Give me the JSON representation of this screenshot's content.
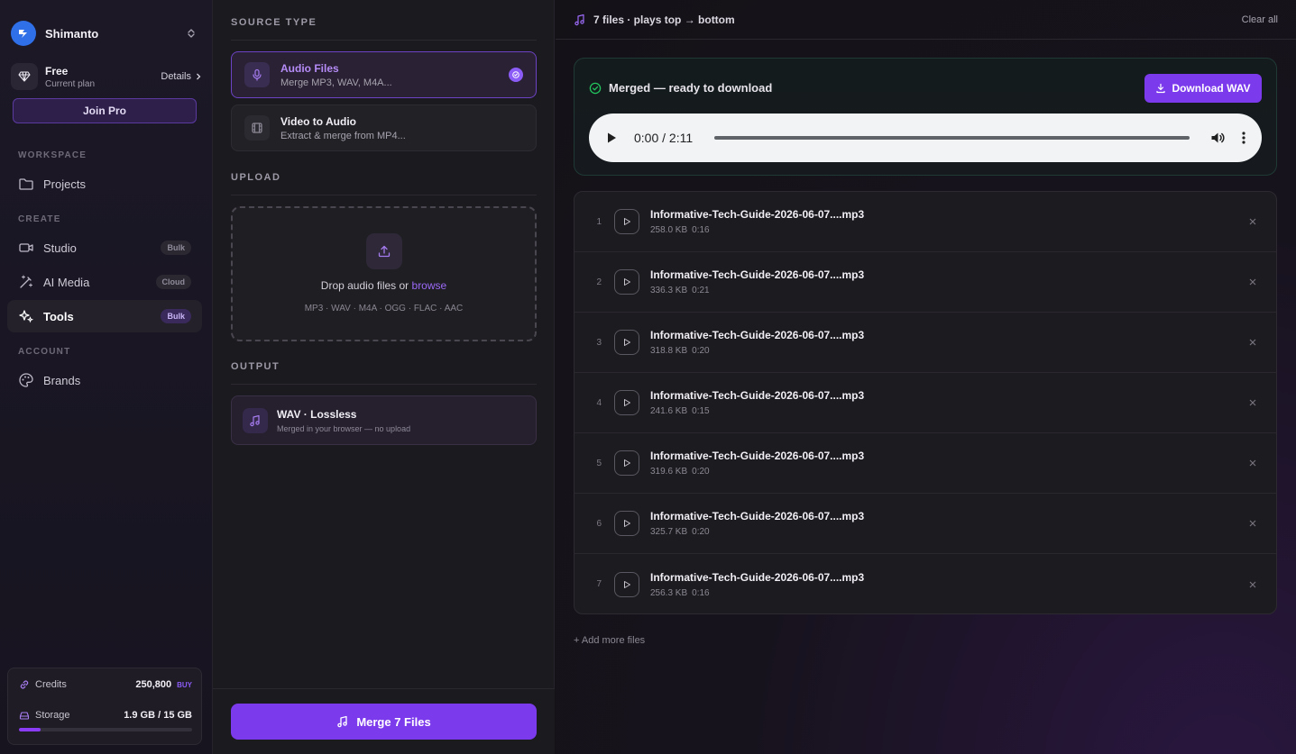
{
  "sidebar": {
    "user_name": "Shimanto",
    "plan": {
      "name": "Free",
      "sub": "Current plan",
      "details": "Details"
    },
    "join_pro": "Join Pro",
    "sections": {
      "workspace": "WORKSPACE",
      "create": "CREATE",
      "account": "ACCOUNT"
    },
    "items": {
      "projects": {
        "label": "Projects",
        "icon": "folder-icon"
      },
      "studio": {
        "label": "Studio",
        "badge": "Bulk",
        "icon": "video-icon"
      },
      "ai_media": {
        "label": "AI Media",
        "badge": "Cloud",
        "icon": "magic-wand-icon"
      },
      "tools": {
        "label": "Tools",
        "badge": "Bulk",
        "icon": "sparkles-icon"
      },
      "brands": {
        "label": "Brands",
        "icon": "palette-icon"
      }
    },
    "usage": {
      "credits_label": "Credits",
      "credits_value": "250,800",
      "buy": "BUY",
      "storage_label": "Storage",
      "storage_value": "1.9 GB / 15 GB",
      "storage_fraction": 0.127
    }
  },
  "middle": {
    "source_type_label": "SOURCE TYPE",
    "sources": [
      {
        "title": "Audio Files",
        "sub": "Merge MP3, WAV, M4A...",
        "selected": true
      },
      {
        "title": "Video to Audio",
        "sub": "Extract & merge from MP4...",
        "selected": false
      }
    ],
    "upload_label": "UPLOAD",
    "drop_text": "Drop audio files or",
    "browse": "browse",
    "formats": "MP3 · WAV · M4A · OGG · FLAC · AAC",
    "output_label": "OUTPUT",
    "output": {
      "title": "WAV · Lossless",
      "sub": "Merged in your browser — no upload"
    },
    "merge_button": "Merge 7 Files"
  },
  "right": {
    "topbar_title": "7 files · plays top → bottom",
    "clear_all": "Clear all",
    "result_status": "Merged — ready to download",
    "download_button": "Download WAV",
    "player_time": "0:00 / 2:11",
    "files": [
      {
        "index": "1",
        "name": "Informative-Tech-Guide-2026-06-07....mp3",
        "size": "258.0 KB",
        "duration": "0:16"
      },
      {
        "index": "2",
        "name": "Informative-Tech-Guide-2026-06-07....mp3",
        "size": "336.3 KB",
        "duration": "0:21"
      },
      {
        "index": "3",
        "name": "Informative-Tech-Guide-2026-06-07....mp3",
        "size": "318.8 KB",
        "duration": "0:20"
      },
      {
        "index": "4",
        "name": "Informative-Tech-Guide-2026-06-07....mp3",
        "size": "241.6 KB",
        "duration": "0:15"
      },
      {
        "index": "5",
        "name": "Informative-Tech-Guide-2026-06-07....mp3",
        "size": "319.6 KB",
        "duration": "0:20"
      },
      {
        "index": "6",
        "name": "Informative-Tech-Guide-2026-06-07....mp3",
        "size": "325.7 KB",
        "duration": "0:20"
      },
      {
        "index": "7",
        "name": "Informative-Tech-Guide-2026-06-07....mp3",
        "size": "256.3 KB",
        "duration": "0:16"
      }
    ],
    "add_more": "+ Add more files"
  },
  "colors": {
    "accent": "#7c3aed",
    "accent_light": "#9b6af7",
    "success": "#22c55e"
  }
}
